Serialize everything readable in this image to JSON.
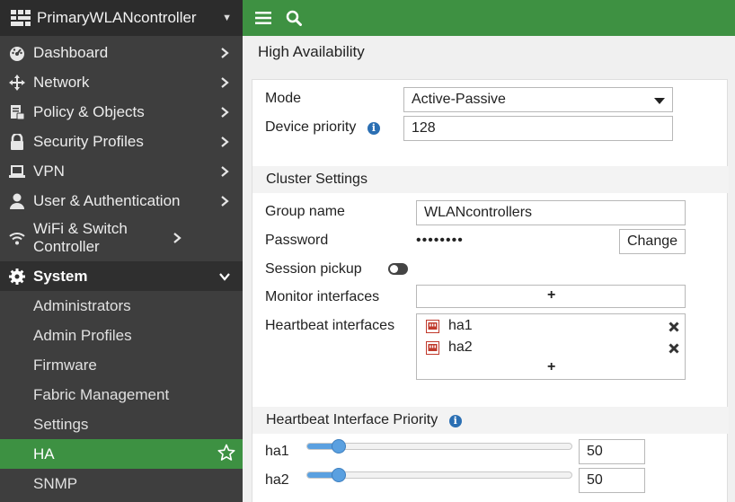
{
  "sidebar": {
    "device_name": "PrimaryWLANcontroller",
    "items": [
      {
        "label": "Dashboard",
        "icon": "dashboard-icon"
      },
      {
        "label": "Network",
        "icon": "network-icon"
      },
      {
        "label": "Policy & Objects",
        "icon": "policy-icon"
      },
      {
        "label": "Security Profiles",
        "icon": "lock-icon"
      },
      {
        "label": "VPN",
        "icon": "laptop-icon"
      },
      {
        "label": "User & Authentication",
        "icon": "user-icon"
      },
      {
        "label": "WiFi & Switch Controller",
        "icon": "wifi-icon"
      },
      {
        "label": "System",
        "icon": "gear-icon"
      }
    ],
    "system_subitems": [
      "Administrators",
      "Admin Profiles",
      "Firmware",
      "Fabric Management",
      "Settings",
      "HA",
      "SNMP"
    ],
    "active_subitem": "HA"
  },
  "topbar": {
    "menu_icon": "hamburger-icon",
    "search_icon": "search-icon"
  },
  "page": {
    "title": "High Availability"
  },
  "form": {
    "mode_label": "Mode",
    "mode_value": "Active-Passive",
    "device_priority_label": "Device priority",
    "device_priority_value": "128",
    "cluster_section": "Cluster Settings",
    "group_name_label": "Group name",
    "group_name_value": "WLANcontrollers",
    "password_label": "Password",
    "password_mask": "••••••••",
    "change_button": "Change",
    "session_pickup_label": "Session pickup",
    "session_pickup_enabled": false,
    "monitor_interfaces_label": "Monitor interfaces",
    "heartbeat_interfaces_label": "Heartbeat interfaces",
    "heartbeat_interfaces": [
      "ha1",
      "ha2"
    ],
    "add_symbol": "+",
    "priority_section": "Heartbeat Interface Priority",
    "priorities": [
      {
        "name": "ha1",
        "value": "50",
        "slider_fraction": 0.12
      },
      {
        "name": "ha2",
        "value": "50",
        "slider_fraction": 0.12
      }
    ]
  },
  "colors": {
    "accent_green": "#3e9142",
    "sidebar_bg": "#3e3e3e",
    "info_blue": "#2b6fb3",
    "slider_blue": "#5aa0e0"
  }
}
